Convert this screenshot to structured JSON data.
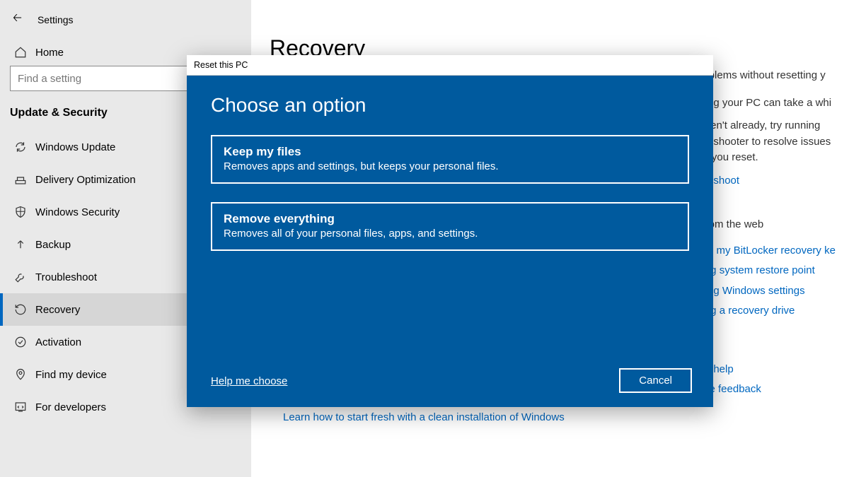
{
  "window": {
    "settings_label": "Settings"
  },
  "sidebar": {
    "home_label": "Home",
    "search_placeholder": "Find a setting",
    "section_label": "Update & Security",
    "items": [
      {
        "label": "Windows Update"
      },
      {
        "label": "Delivery Optimization"
      },
      {
        "label": "Windows Security"
      },
      {
        "label": "Backup"
      },
      {
        "label": "Troubleshoot"
      },
      {
        "label": "Recovery"
      },
      {
        "label": "Activation"
      },
      {
        "label": "Find my device"
      },
      {
        "label": "For developers"
      }
    ]
  },
  "main": {
    "title": "Recovery",
    "right_para_1": "problems without resetting y",
    "right_para_2": "etting your PC can take a whi",
    "right_para_3": "haven't already, try running",
    "right_para_4": "ubleshooter to resolve issues",
    "right_para_5": "ore you reset.",
    "right_link_troubleshoot": "ubleshoot",
    "right_heading_web": "p from the web",
    "right_link_bitlocker": "ding my BitLocker recovery ke",
    "right_link_restore": "ating system restore point",
    "right_link_reset": "etting Windows settings",
    "right_link_drive": "ating a recovery drive",
    "right_link_gethelp": "Get help",
    "right_link_feedback": "Give feedback",
    "learn_fresh": "Learn how to start fresh with a clean installation of Windows"
  },
  "dialog": {
    "titlebar": "Reset this PC",
    "heading": "Choose an option",
    "option1_title": "Keep my files",
    "option1_desc": "Removes apps and settings, but keeps your personal files.",
    "option2_title": "Remove everything",
    "option2_desc": "Removes all of your personal files, apps, and settings.",
    "help_link": "Help me choose",
    "cancel_label": "Cancel"
  }
}
